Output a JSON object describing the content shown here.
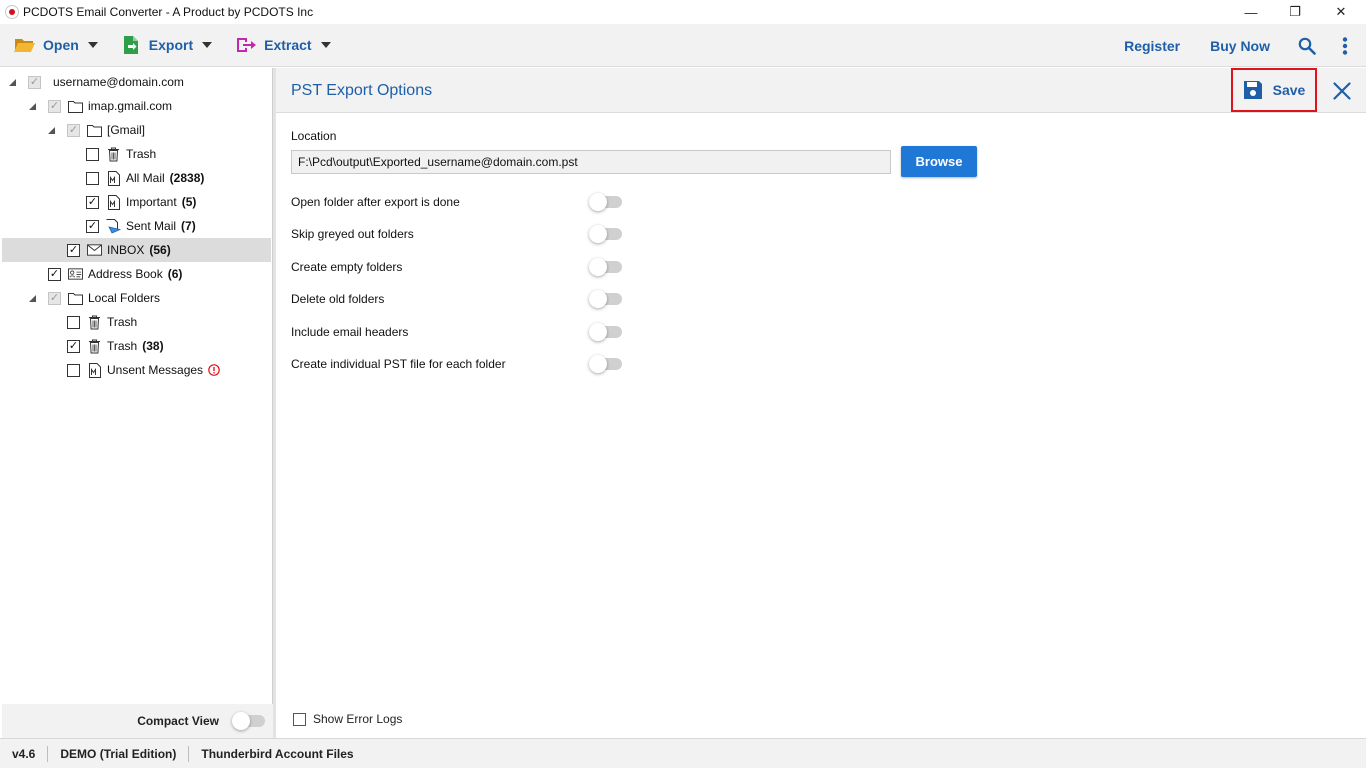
{
  "window": {
    "title": "PCDOTS Email Converter - A Product by PCDOTS Inc",
    "minimize_glyph": "—",
    "restore_glyph": "❐",
    "close_glyph": "✕"
  },
  "toolbar": {
    "open_label": "Open",
    "export_label": "Export",
    "extract_label": "Extract",
    "register_label": "Register",
    "buy_now_label": "Buy Now"
  },
  "tree": [
    {
      "label": "username@domain.com",
      "count": "",
      "check": "grey",
      "icon": "none",
      "expander": true
    },
    {
      "label": "imap.gmail.com",
      "count": "",
      "check": "grey",
      "icon": "folder-icon",
      "expander": true
    },
    {
      "label": "[Gmail]",
      "count": "",
      "check": "grey",
      "icon": "folder-icon",
      "expander": true
    },
    {
      "label": "Trash",
      "count": "",
      "check": "unchecked",
      "icon": "trash-icon",
      "expander": false
    },
    {
      "label": "All Mail",
      "count": "(2838)",
      "check": "unchecked",
      "icon": "mail-file-icon",
      "expander": false
    },
    {
      "label": "Important",
      "count": "(5)",
      "check": "checked",
      "icon": "mail-file-icon",
      "expander": false
    },
    {
      "label": "Sent Mail",
      "count": "(7)",
      "check": "checked",
      "icon": "sent-icon",
      "expander": false
    },
    {
      "label": "INBOX",
      "count": "(56)",
      "check": "checked",
      "icon": "envelope-icon",
      "expander": false,
      "selected": true
    },
    {
      "label": "Address Book",
      "count": "(6)",
      "check": "checked",
      "icon": "contact-card-icon",
      "expander": false
    },
    {
      "label": "Local Folders",
      "count": "",
      "check": "grey",
      "icon": "folder-icon",
      "expander": true
    },
    {
      "label": "Trash",
      "count": "",
      "check": "unchecked",
      "icon": "trash-icon",
      "expander": false
    },
    {
      "label": "Trash",
      "count": "(38)",
      "check": "checked",
      "icon": "trash-icon",
      "expander": false
    },
    {
      "label": "Unsent Messages",
      "count": "",
      "check": "unchecked",
      "icon": "mail-file-icon",
      "expander": false,
      "warning": true
    }
  ],
  "left_footer": {
    "compact_view_label": "Compact View",
    "compact_view_on": false
  },
  "export_panel": {
    "title": "PST Export Options",
    "save_label": "Save",
    "location_label": "Location",
    "location_value": "F:\\Pcd\\output\\Exported_username@domain.com.pst",
    "browse_label": "Browse",
    "options": [
      {
        "label": "Open folder after export is done",
        "on": false
      },
      {
        "label": "Skip greyed out folders",
        "on": false
      },
      {
        "label": "Create empty folders",
        "on": false
      },
      {
        "label": "Delete old folders",
        "on": false
      },
      {
        "label": "Include email headers",
        "on": false
      },
      {
        "label": "Create individual PST file for each folder",
        "on": false
      }
    ],
    "show_error_logs_label": "Show Error Logs",
    "show_error_logs_checked": false
  },
  "statusbar": {
    "version": "v4.6",
    "edition": "DEMO (Trial Edition)",
    "source": "Thunderbird Account Files"
  },
  "colors": {
    "accent": "#1f5fa8",
    "browse_button": "#1f77d6",
    "save_highlight": "#e0121b",
    "open_icon": "#e8a317",
    "export_icon": "#2e9e47",
    "extract_icon": "#c428b0"
  }
}
